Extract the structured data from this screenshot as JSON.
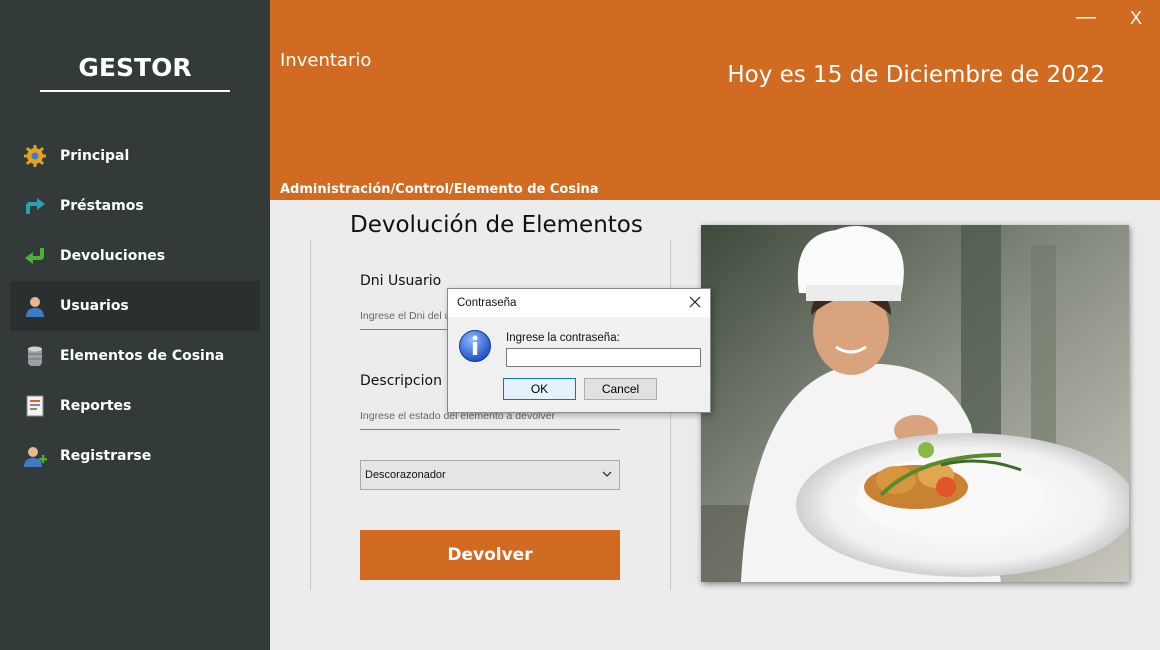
{
  "sidebar": {
    "brand": "GESTOR",
    "items": [
      {
        "label": "Principal",
        "icon": "gear-gold-icon"
      },
      {
        "label": "Préstamos",
        "icon": "arrow-loan-icon"
      },
      {
        "label": "Devoluciones",
        "icon": "arrow-return-icon"
      },
      {
        "label": "Usuarios",
        "icon": "user-icon"
      },
      {
        "label": "Elementos de Cosina",
        "icon": "database-icon"
      },
      {
        "label": "Reportes",
        "icon": "report-icon"
      },
      {
        "label": "Registrarse",
        "icon": "add-user-icon"
      }
    ],
    "active_item": "Usuarios"
  },
  "header": {
    "title": "Inventario",
    "date": "Hoy es 15 de Diciembre de 2022",
    "breadcrumb": "Administración/Control/Elemento de Cosina",
    "minimize": "—",
    "close": "X"
  },
  "form": {
    "title": "Devolución de Elementos",
    "dni_label": "Dni Usuario",
    "dni_placeholder": "Ingrese el Dni del usuario",
    "desc_label": "Descripcion",
    "desc_placeholder": "Ingrese el estado del elemento a devolver",
    "element_selected": "Descorazonador",
    "submit": "Devolver"
  },
  "dialog": {
    "title": "Contraseña",
    "prompt": "Ingrese la contraseña:",
    "input_value": "",
    "ok": "OK",
    "cancel": "Cancel",
    "icon": "info-icon"
  },
  "colors": {
    "accent": "#d26b22",
    "sidebar": "#323a3a",
    "background": "#ececec"
  }
}
